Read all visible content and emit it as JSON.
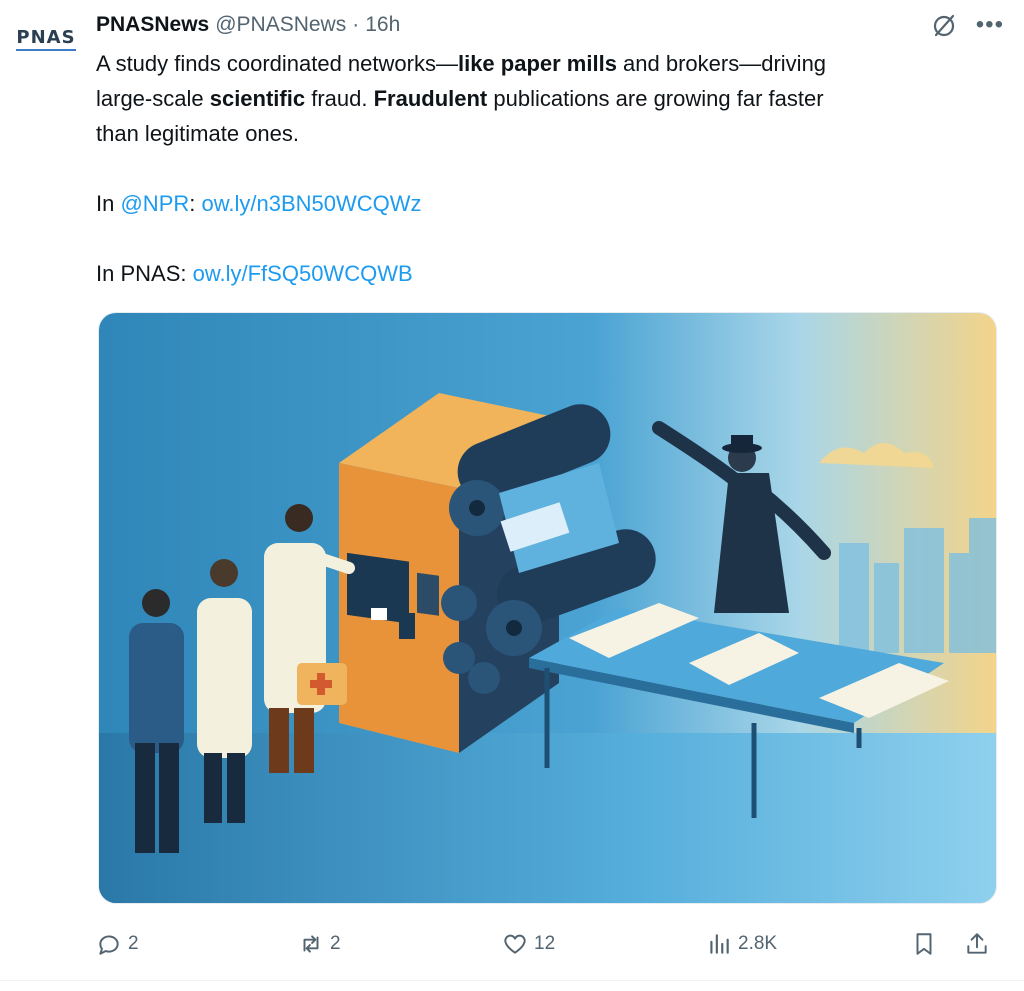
{
  "author": {
    "avatar_text": "PNAS",
    "name": "PNASNews",
    "handle": "@PNASNews",
    "separator": "·",
    "time": "16h"
  },
  "tweet": {
    "line1_a": "A study finds coordinated networks—",
    "line1_b": "like paper mills",
    "line1_c": " and brokers—driving",
    "line2_a": "large-scale ",
    "line2_b": "scientific",
    "line2_c": " fraud. ",
    "line2_d": "Fraudulent",
    "line2_e": " publications are growing far faster",
    "line3": "than legitimate ones.",
    "npr_prefix": "In ",
    "npr_mention": "@NPR",
    "npr_colon": ": ",
    "npr_link": "ow.ly/n3BN50WCQWz",
    "pnas_prefix": "In PNAS: ",
    "pnas_link": "ow.ly/FfSQ50WCQWB"
  },
  "actions": {
    "replies": "2",
    "reposts": "2",
    "likes": "12",
    "views": "2.8K"
  },
  "icons": {
    "grok": "grok-icon",
    "more": "more-icon",
    "reply": "reply-icon",
    "repost": "repost-icon",
    "like": "heart-icon",
    "views": "views-icon",
    "bookmark": "bookmark-icon",
    "share": "share-icon"
  },
  "colors": {
    "link": "#1d9bf0",
    "muted": "#536471",
    "text": "#0f1419"
  }
}
